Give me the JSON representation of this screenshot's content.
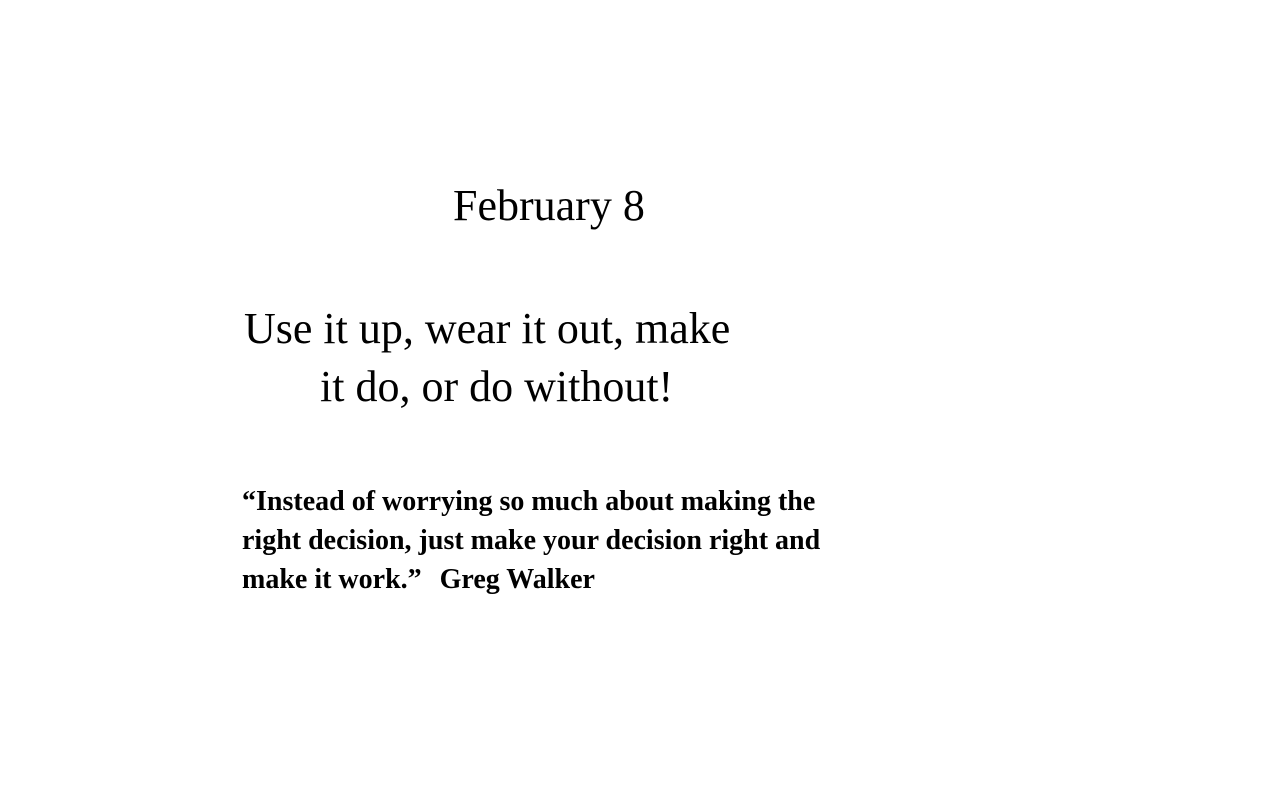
{
  "date": "February 8",
  "motto": {
    "line1": "Use it up, wear it out, make",
    "line2": "it do, or do without!"
  },
  "quote": {
    "line1": "“Instead of worrying so much about making the",
    "line2": "right decision, just make your decision right and",
    "line3": "make it work.”",
    "attribution": "Greg Walker"
  }
}
